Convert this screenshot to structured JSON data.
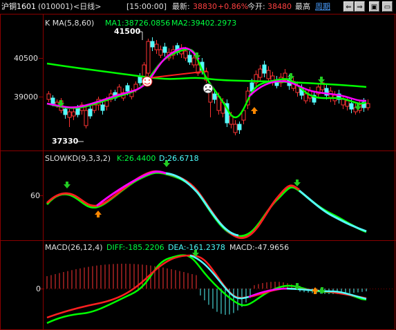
{
  "header": {
    "symbol": "沪铜1601",
    "code": "(010001)",
    "period": "<日线>",
    "time": "[15:00:00]",
    "latest_label": "最新:",
    "latest_value": "38830",
    "change_pct": "+0.86%",
    "open_label": "今开:",
    "open_value": "38480",
    "high_label": "最高",
    "period_link": "周期",
    "buttons": [
      "⇐",
      "⇒",
      "▣",
      "▭"
    ]
  },
  "panel_main": {
    "title": "K  MA(5,8,60)",
    "ma1": "MA1:38726.0856",
    "ma2": "MA2:39402.2973",
    "y_ticks": [
      "40500",
      "39000"
    ],
    "high_mark": "41500",
    "low_mark": "37330"
  },
  "panel_kd": {
    "title": "SLOWKD(9,3,3,2)",
    "k": "K:26.4400",
    "d": "D:26.6718",
    "y_ticks": [
      "60"
    ]
  },
  "panel_macd": {
    "title": "MACD(26,12,4)",
    "diff": "DIFF:-185.2206",
    "dea": "DEA:-161.2378",
    "macd": "MACD:-47.9656",
    "y_ticks": [
      "0"
    ]
  },
  "colors": {
    "up": "#ff3333",
    "down": "#54fcfc",
    "ma_short": "#ff00ff",
    "ma_mid": "#00ff00",
    "ma_long_red": "#ff2020",
    "grid": "#8b0000",
    "text_red": "#ff4040",
    "text_green": "#00ff40",
    "text_cyan": "#4dfcfc",
    "text_white": "#e0e0e0"
  }
}
